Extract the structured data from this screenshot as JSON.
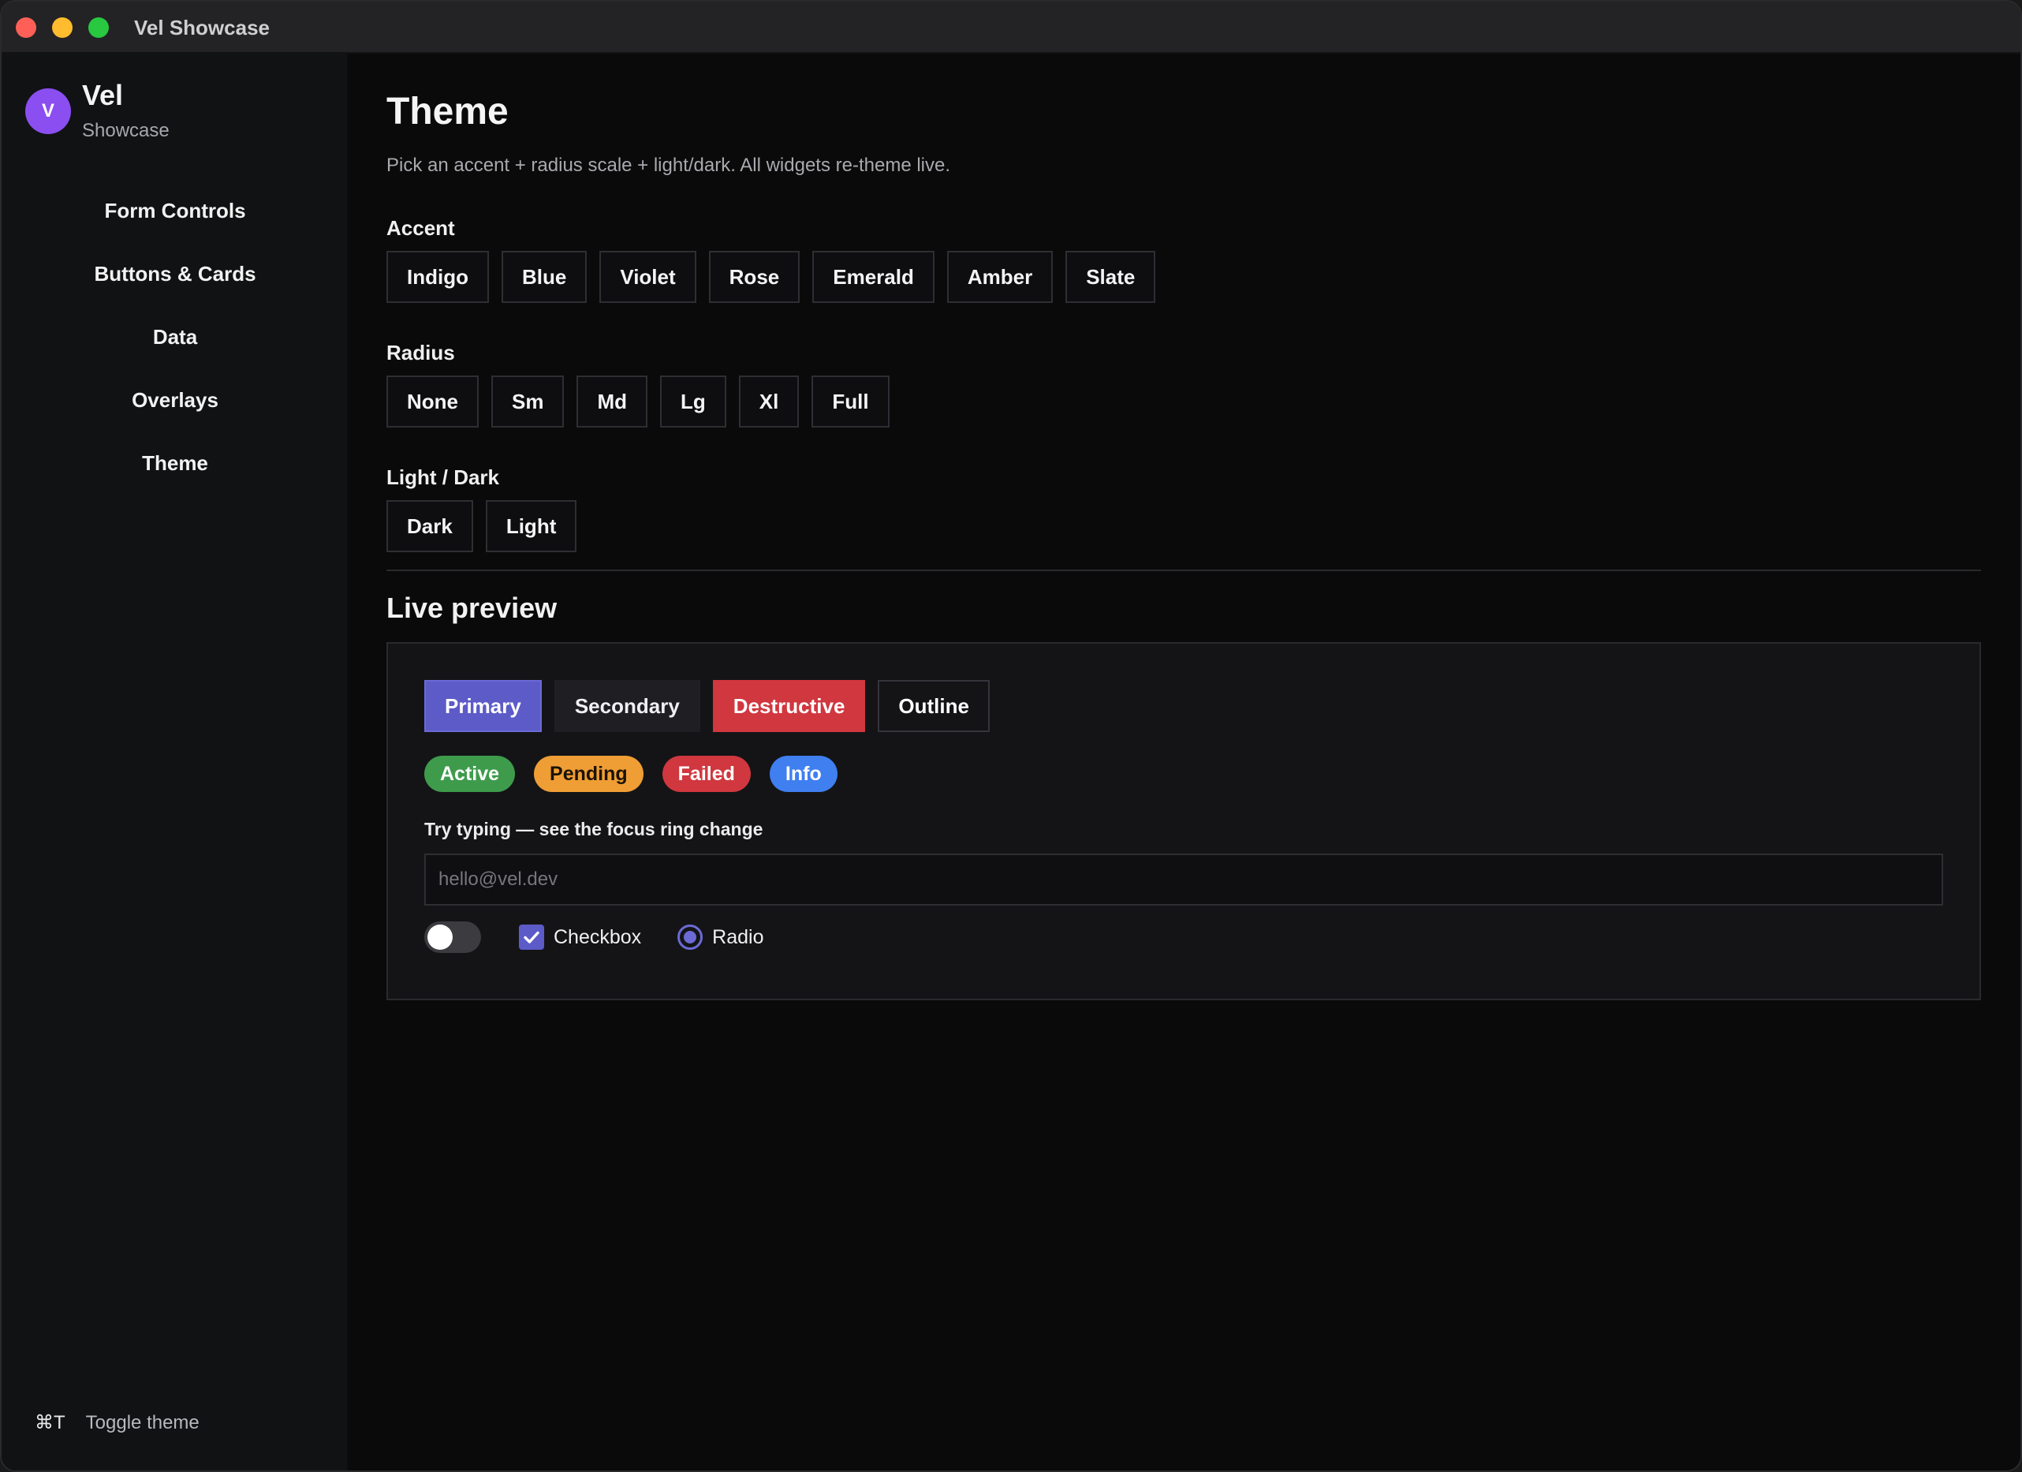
{
  "window": {
    "title": "Vel Showcase"
  },
  "sidebar": {
    "brand": {
      "avatar_letter": "V",
      "name": "Vel",
      "subtitle": "Showcase"
    },
    "items": [
      {
        "label": "Form Controls"
      },
      {
        "label": "Buttons & Cards"
      },
      {
        "label": "Data"
      },
      {
        "label": "Overlays"
      },
      {
        "label": "Theme"
      }
    ],
    "footer": {
      "shortcut": "⌘T",
      "label": "Toggle theme"
    }
  },
  "main": {
    "title": "Theme",
    "description": "Pick an accent + radius scale + light/dark. All widgets re-theme live.",
    "accent": {
      "label": "Accent",
      "options": [
        "Indigo",
        "Blue",
        "Violet",
        "Rose",
        "Emerald",
        "Amber",
        "Slate"
      ]
    },
    "radius": {
      "label": "Radius",
      "options": [
        "None",
        "Sm",
        "Md",
        "Lg",
        "Xl",
        "Full"
      ]
    },
    "mode": {
      "label": "Light / Dark",
      "options": [
        "Dark",
        "Light"
      ]
    },
    "preview": {
      "title": "Live preview",
      "buttons": {
        "primary": "Primary",
        "secondary": "Secondary",
        "destructive": "Destructive",
        "outline": "Outline"
      },
      "badges": {
        "active": "Active",
        "pending": "Pending",
        "failed": "Failed",
        "info": "Info"
      },
      "input": {
        "label": "Try typing — see the focus ring change",
        "placeholder": "hello@vel.dev",
        "value": ""
      },
      "toggle": {
        "on": false
      },
      "checkbox": {
        "label": "Checkbox",
        "checked": true
      },
      "radio": {
        "label": "Radio",
        "selected": true
      }
    }
  },
  "colors": {
    "accent": "#5c5bc8",
    "destructive": "#d0373f",
    "success": "#3e9b4c",
    "warning": "#ef9e35",
    "info": "#3f7ff0",
    "avatar": "#8b4ef0"
  },
  "icons": {
    "checkbox": "check-icon",
    "traffic_lights": [
      "close-icon",
      "minimize-icon",
      "zoom-icon"
    ]
  }
}
